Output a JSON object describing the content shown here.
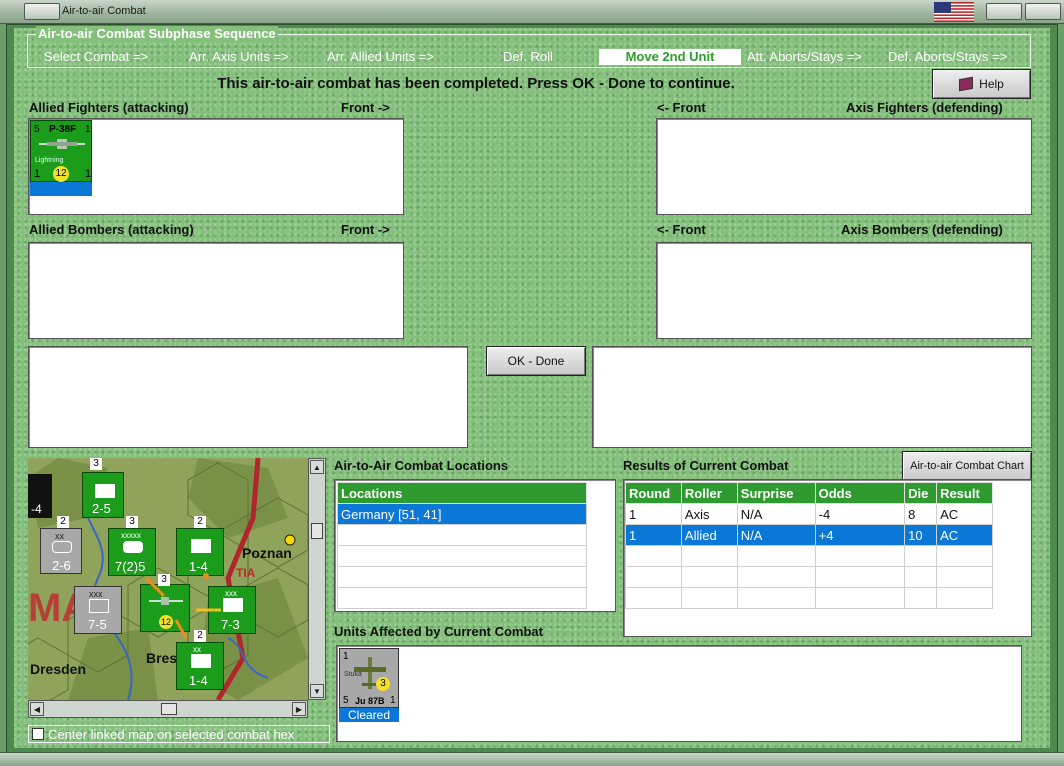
{
  "window": {
    "title": "Air-to-air Combat"
  },
  "phases": {
    "legend": "Air-to-air Combat Subphase Sequence",
    "items": [
      "Select Combat =>",
      "Arr. Axis Units =>",
      "Arr. Allied Units =>",
      "Def. Roll",
      "Move 2nd Unit",
      "Att. Aborts/Stays =>",
      "Def. Aborts/Stays =>"
    ],
    "current_index": 4
  },
  "message": "This air-to-air combat has been completed.  Press OK - Done to continue.",
  "help_label": "Help",
  "fighters": {
    "allied_label": "Allied Fighters (attacking)",
    "front_right": "Front ->",
    "front_left": "<- Front",
    "axis_label": "Axis Fighters (defending)"
  },
  "bombers": {
    "allied_label": "Allied Bombers (attacking)",
    "front_right": "Front ->",
    "front_left": "<- Front",
    "axis_label": "Axis Bombers (defending)"
  },
  "allied_counter": {
    "type": "P-38F",
    "name": "Lightning",
    "top_left": "5",
    "top_right": "1",
    "bottom_left": "1",
    "bottom_right": "1",
    "range": "12"
  },
  "ok_done_label": "OK - Done",
  "locations": {
    "title": "Air-to-Air Combat Locations",
    "header": "Locations",
    "rows": [
      "Germany [51, 41]"
    ]
  },
  "results": {
    "title": "Results of Current Combat",
    "chart_button": "Air-to-air Combat Chart",
    "headers": [
      "Round",
      "Roller",
      "Surprise",
      "Odds",
      "Die",
      "Result"
    ],
    "rows": [
      [
        "1",
        "Axis",
        "N/A",
        "-4",
        "8",
        "AC"
      ],
      [
        "1",
        "Allied",
        "N/A",
        "+4",
        "10",
        "AC"
      ]
    ]
  },
  "affected": {
    "title": "Units Affected by Current Combat",
    "unit": {
      "type": "Ju 87B",
      "name": "Stuka",
      "top_left": "1",
      "bottom_left": "5",
      "bottom_right": "1",
      "range": "3",
      "status": "Cleared"
    }
  },
  "map": {
    "cities": [
      "Poznan",
      "Dresden",
      "Bres"
    ],
    "counters": [
      "2-5",
      "2-6",
      "7(2)5",
      "1-4",
      "7-5",
      "7-3",
      "1-4",
      "-4"
    ],
    "pieces": [
      "3",
      "2",
      "3",
      "2",
      "3",
      "2",
      "2"
    ],
    "sizes": [
      "xx",
      "xxxxx",
      "xxx",
      "xxx",
      "xx",
      "xx"
    ],
    "country_text": "MA",
    "region_text": "TIA"
  },
  "center_map_label": "Center linked map on selected combat hex",
  "colors": {
    "felt": "#84c07c",
    "header_green": "#2f9a2f",
    "select_blue": "#0b78d7",
    "counter_green": "#1b9c1b",
    "counter_grey": "#a8a8a8"
  }
}
